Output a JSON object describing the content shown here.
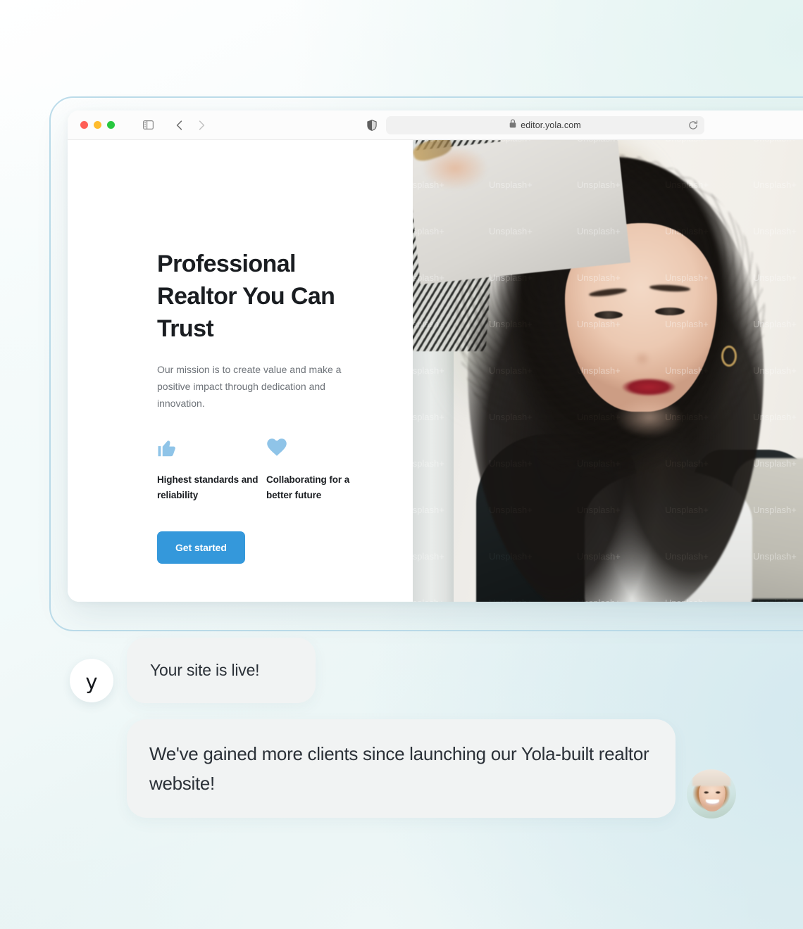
{
  "browser": {
    "traffic_lights": [
      "close",
      "minimize",
      "zoom"
    ],
    "sidebar_toggle_icon": "sidebar-icon",
    "back_icon": "chevron-left-icon",
    "forward_icon": "chevron-right-icon",
    "shield_icon": "shield-icon",
    "lock_icon": "lock-icon",
    "url": "editor.yola.com",
    "reload_icon": "reload-icon"
  },
  "site": {
    "hero": {
      "title": "Professional Realtor You Can Trust",
      "subtitle": "Our mission is to create value and make a positive impact through dedication and innovation.",
      "cta_label": "Get started",
      "cta_color": "#3498db",
      "features": [
        {
          "icon": "thumbs-up-icon",
          "icon_color": "#8fc4e8",
          "label": "Highest standards and reliability"
        },
        {
          "icon": "heart-icon",
          "icon_color": "#8fc4e8",
          "label": "Collaborating for a better future"
        }
      ],
      "photo": {
        "alt": "Realtor woman with curly dark hair working on a laptop",
        "watermark": "Unsplash+"
      }
    }
  },
  "chat": {
    "yola_avatar_logo": "y",
    "messages": [
      {
        "from": "yola",
        "text": "Your site is live!"
      },
      {
        "from": "client",
        "text": "We've gained more clients since launching our Yola-built realtor website!"
      }
    ],
    "client_avatar": "smiling-woman-photo"
  },
  "theme": {
    "background_top_left": "#ffffff",
    "background_top_right": "#e2f3f1",
    "background_mid_right": "#d4e9ef",
    "frame_border": "#bcdcea",
    "bubble_background": "#f1f3f3",
    "text_primary": "#1a1d21",
    "text_secondary": "#6e7379"
  }
}
